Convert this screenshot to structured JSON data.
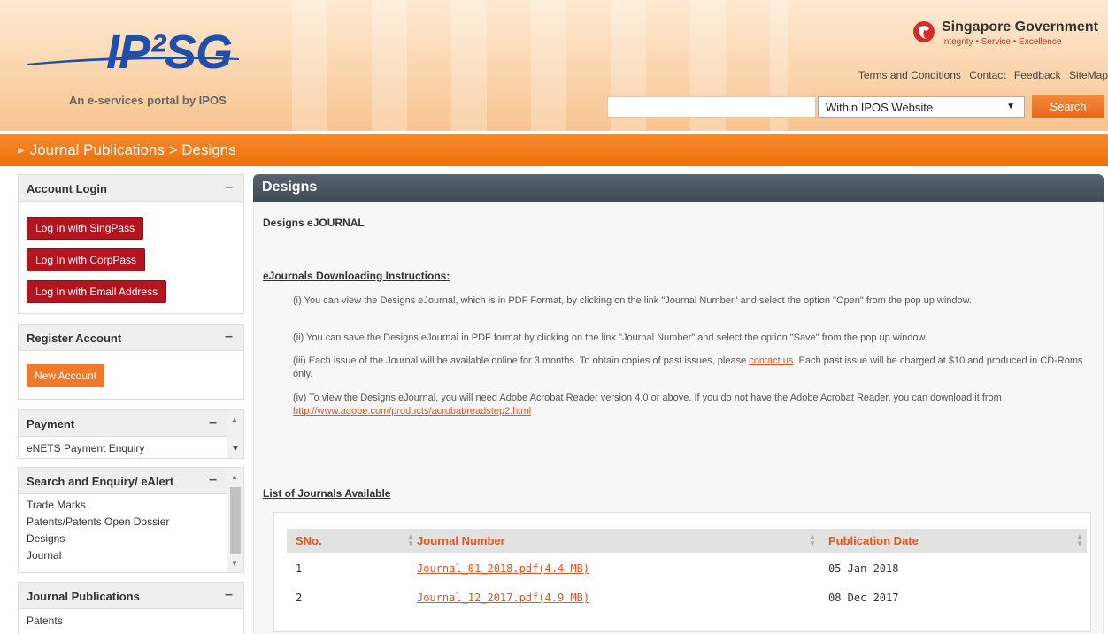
{
  "header": {
    "logo_text": "IP²SG",
    "tagline": "An e-services portal by IPOS",
    "gov_title": "Singapore Government",
    "gov_sub": "Integrity • Service • Excellence",
    "links": [
      "Terms and Conditions",
      "Contact",
      "Feedback",
      "SiteMap"
    ],
    "search": {
      "placeholder": "",
      "scope": "Within IPOS Website",
      "button": "Search"
    }
  },
  "breadcrumb": "Journal Publications > Designs",
  "sidebar": {
    "account_login": {
      "title": "Account Login",
      "buttons": [
        "Log In with SingPass",
        "Log In with CorpPass",
        "Log In with Email Address"
      ]
    },
    "register": {
      "title": "Register Account",
      "button": "New Account"
    },
    "payment": {
      "title": "Payment",
      "items": [
        "eNETS Payment Enquiry"
      ]
    },
    "search_enquiry": {
      "title": "Search and Enquiry/ eAlert",
      "items": [
        "Trade Marks",
        "Patents/Patents Open Dossier",
        "Designs",
        "Journal"
      ]
    },
    "journal_publications": {
      "title": "Journal Publications",
      "items": [
        "Patents"
      ]
    }
  },
  "main": {
    "title": "Designs",
    "subtitle": "Designs eJOURNAL",
    "instructions_title": "eJournals Downloading Instructions:",
    "instructions": {
      "i": "(i) You can view the Designs eJournal, which is in PDF Format, by clicking on the link \"Journal Number\" and select the option \"Open\" from the pop up window.",
      "ii": "(ii) You can save the Designs eJournal in PDF format by clicking on the link \"Journal Number\" and select the option \"Save\" from the pop up window.",
      "iii_a": "(iii) Each issue of the Journal will be available online for 3 months. To obtain copies of past issues, please",
      "iii_link": "contact us",
      "iii_b": ". Each past issue will be charged at $10 and produced in CD-Roms only.",
      "iv_a": "(iv) To view the Designs eJournal, you will need Adobe Acrobat Reader version 4.0 or above. If you do not have the Adobe Acrobat Reader, you can download it from",
      "iv_link": "http://www.adobe.com/products/acrobat/readstep2.html"
    },
    "list_title": "List of Journals Available",
    "table": {
      "headers": [
        "SNo.",
        "Journal Number",
        "Publication Date"
      ],
      "rows": [
        {
          "sno": "1",
          "journal": "Journal_01_2018.pdf(4.4 MB)",
          "date": "05 Jan 2018"
        },
        {
          "sno": "2",
          "journal": "Journal_12_2017.pdf(4.9 MB)",
          "date": "08 Dec 2017"
        }
      ]
    }
  }
}
